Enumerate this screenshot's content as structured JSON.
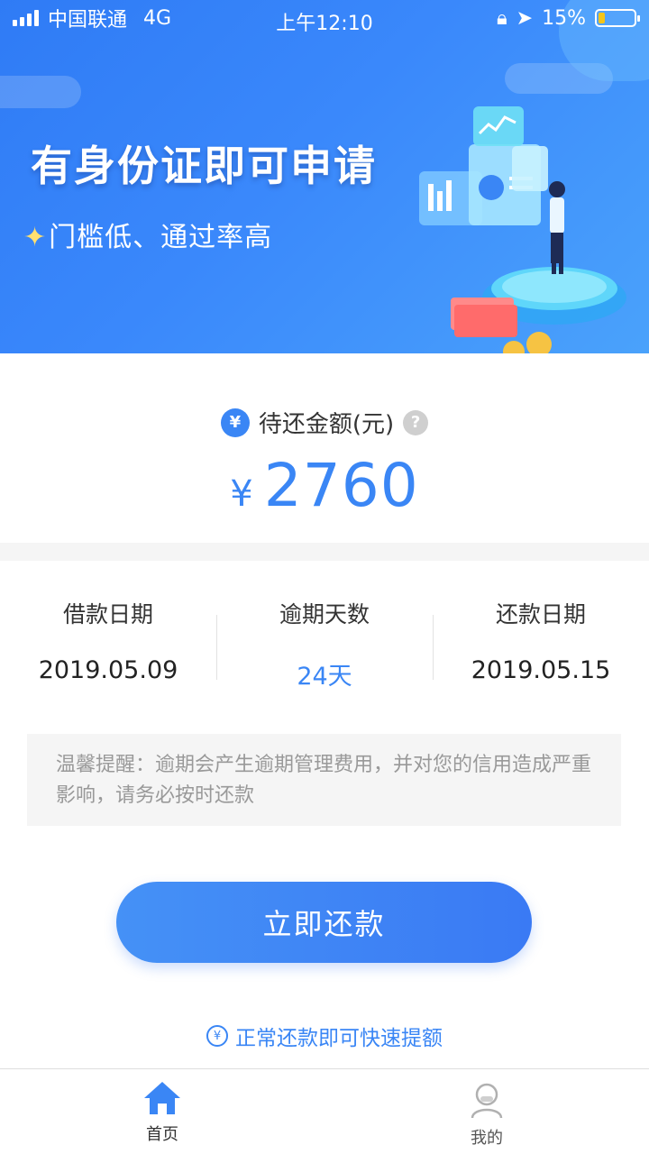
{
  "status_bar": {
    "carrier": "中国联通",
    "network": "4G",
    "time": "上午12:10",
    "battery": "15%",
    "battery_level": 0.15
  },
  "banner": {
    "title": "有身份证即可申请",
    "subtitle": "门槛低、通过率高"
  },
  "amount": {
    "label": "待还金额(元)",
    "currency_symbol": "¥",
    "value": "2760",
    "label_icon": "yen-circle-icon",
    "help_icon": "question-circle-icon"
  },
  "info": [
    {
      "label": "借款日期",
      "value": "2019.05.09"
    },
    {
      "label": "逾期天数",
      "value": "24天"
    },
    {
      "label": "还款日期",
      "value": "2019.05.15"
    }
  ],
  "notice": {
    "text": "温馨提醒：逾期会产生逾期管理费用，并对您的信用造成严重影响，请务必按时还款"
  },
  "repay_button": {
    "label": "立即还款"
  },
  "quota_tip": {
    "text": "正常还款即可快速提额",
    "icon": "quota-up-icon"
  },
  "tab_bar": {
    "items": [
      {
        "label": "首页",
        "icon": "home-icon",
        "active": true
      },
      {
        "label": "我的",
        "icon": "user-icon",
        "active": false
      }
    ]
  },
  "colors": {
    "accent": "#3a86f5",
    "banner_start": "#2f7bf5",
    "notice_bg": "#f5f5f5",
    "notice_text": "#999999"
  }
}
